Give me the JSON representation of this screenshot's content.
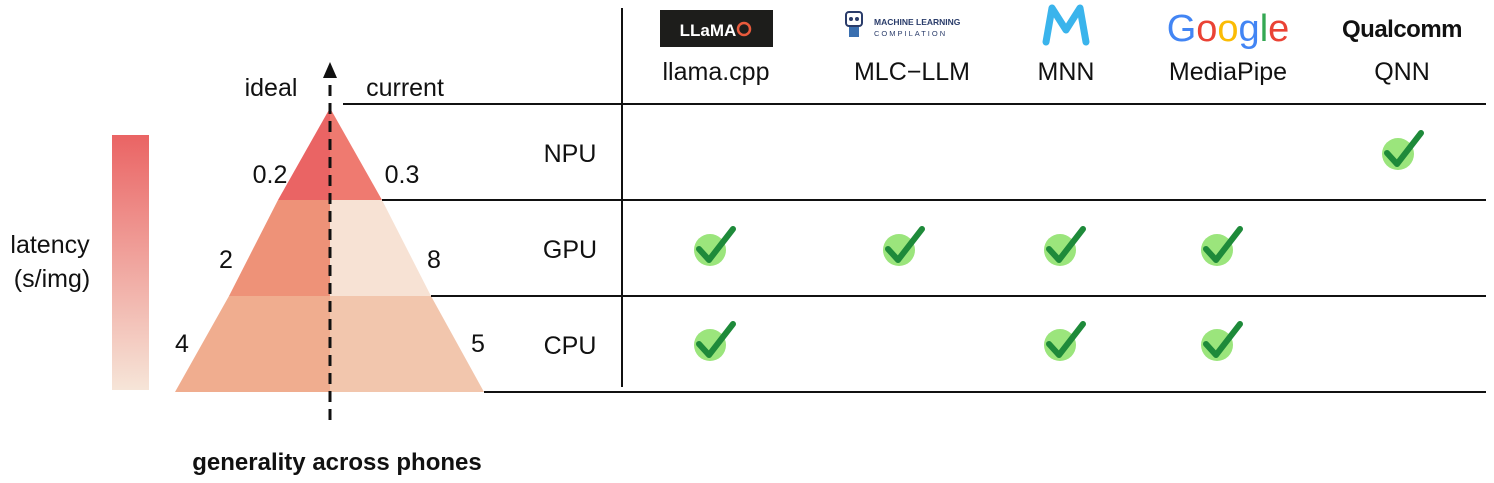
{
  "legend": {
    "title_line1": "latency",
    "title_line2": "(s/img)",
    "color_top": "#ea6464",
    "color_bottom": "#f6e5d8"
  },
  "pyramid": {
    "left_label": "ideal",
    "right_label": "current",
    "x_axis_label": "generality across phones",
    "levels": [
      {
        "name": "NPU",
        "ideal": "0.2",
        "current": "0.3",
        "ideal_color": "#ea6464",
        "current_color": "#ef7a70"
      },
      {
        "name": "GPU",
        "ideal": "2",
        "current": "8",
        "ideal_color": "#ee9278",
        "current_color": "#f7e2d4"
      },
      {
        "name": "CPU",
        "ideal": "4",
        "current": "5",
        "ideal_color": "#f0ad8f",
        "current_color": "#f2c6ad"
      }
    ]
  },
  "frameworks": [
    {
      "name": "llama.cpp",
      "logo": "LLaMA",
      "logo_icon": "llama-logo-icon",
      "NPU": false,
      "GPU": true,
      "CPU": true
    },
    {
      "name": "MLC−LLM",
      "logo_line1": "MACHINE LEARNING",
      "logo_line2": "COMPILATION",
      "logo_icon": "robot-logo-icon",
      "NPU": false,
      "GPU": true,
      "CPU": false
    },
    {
      "name": "MNN",
      "logo_icon": "mnn-m-logo-icon",
      "NPU": false,
      "GPU": true,
      "CPU": true
    },
    {
      "name": "MediaPipe",
      "logo": "Google",
      "logo_icon": "google-logo-icon",
      "NPU": false,
      "GPU": true,
      "CPU": true
    },
    {
      "name": "QNN",
      "logo": "Qualcomm",
      "logo_icon": "qualcomm-logo-icon",
      "NPU": true,
      "GPU": false,
      "CPU": false
    }
  ],
  "check_icon": "checkmark-icon",
  "check_colors": {
    "circle": "#9be57c",
    "mark": "#1e8a3a"
  }
}
